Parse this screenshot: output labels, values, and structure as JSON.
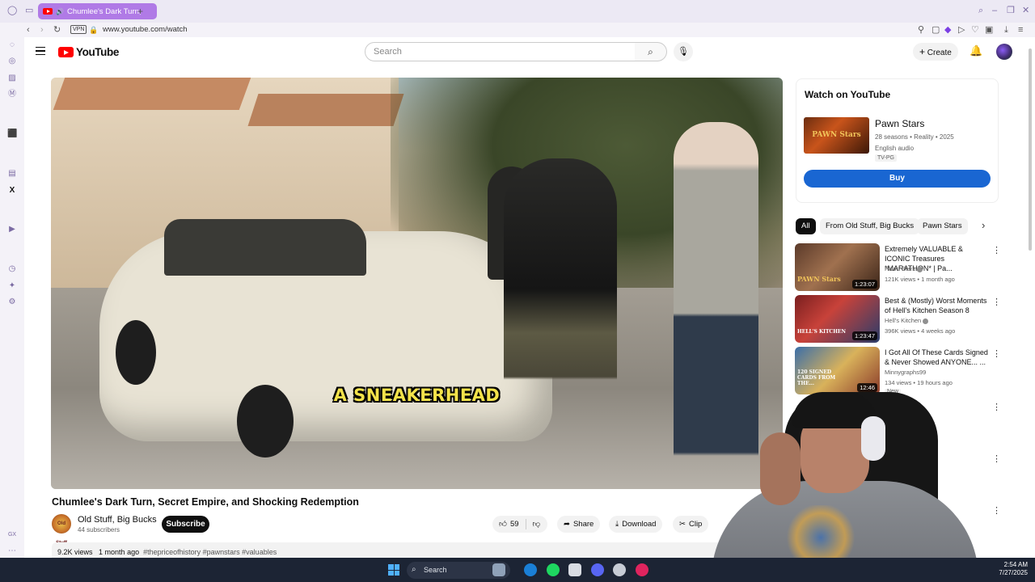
{
  "browser": {
    "tab_title": "Chumlee's Dark Turn,",
    "url": "www.youtube.com/watch",
    "vpn_label": "VPN"
  },
  "header": {
    "logo_text": "YouTube",
    "search_placeholder": "Search",
    "create_label": "Create"
  },
  "video": {
    "caption": "A SNEAKERHEAD",
    "title": "Chumlee's Dark Turn, Secret Empire, and Shocking Redemption",
    "channel": "Old Stuff, Big Bucks",
    "channel_avatar_text": "Old Stuff",
    "subscribers": "44 subscribers",
    "subscribe_label": "Subscribe",
    "likes": "59",
    "share_label": "Share",
    "download_label": "Download",
    "clip_label": "Clip",
    "views": "9.2K views",
    "age": "1 month ago",
    "tags": "#thepriceofhistory #pawnstars #valuables"
  },
  "watch_card": {
    "heading": "Watch on YouTube",
    "show_name": "Pawn Stars",
    "meta": "28 seasons • Reality • 2025",
    "audio": "English audio",
    "rating": "TV-PG",
    "thumb_text": "PAWN Stars",
    "buy_label": "Buy"
  },
  "chips": [
    "All",
    "From Old Stuff, Big Bucks",
    "Pawn Stars"
  ],
  "recommendations": [
    {
      "title": "Extremely VALUABLE & ICONIC Treasures *MARATHON* | Pa...",
      "channel": "Pawn Stars",
      "views": "121K views • 1 month ago",
      "duration": "1:23:07",
      "thumb_text": "PAWN Stars",
      "new": ""
    },
    {
      "title": "Best & (Mostly) Worst Moments of Hell's Kitchen Season 8",
      "channel": "Hell's Kitchen",
      "views": "396K views • 4 weeks ago",
      "duration": "1:23:47",
      "thumb_text": "HELL'S KITCHEN",
      "new": ""
    },
    {
      "title": "I Got All Of These Cards Signed & Never Showed ANYONE... ...",
      "channel": "Minnygraphs99",
      "views": "134 views • 19 hours ago",
      "duration": "12:46",
      "thumb_text": "120 SIGNED CARDS FROM THE...",
      "new": "New"
    }
  ],
  "taskbar": {
    "search_label": "Search",
    "time": "2:54 AM",
    "date": "7/27/2025"
  },
  "colors": {
    "youtube_red": "#ff0000",
    "buy_blue": "#1966d2",
    "opera_tab": "#b07ae6",
    "caption_yellow": "#f3e24a"
  }
}
